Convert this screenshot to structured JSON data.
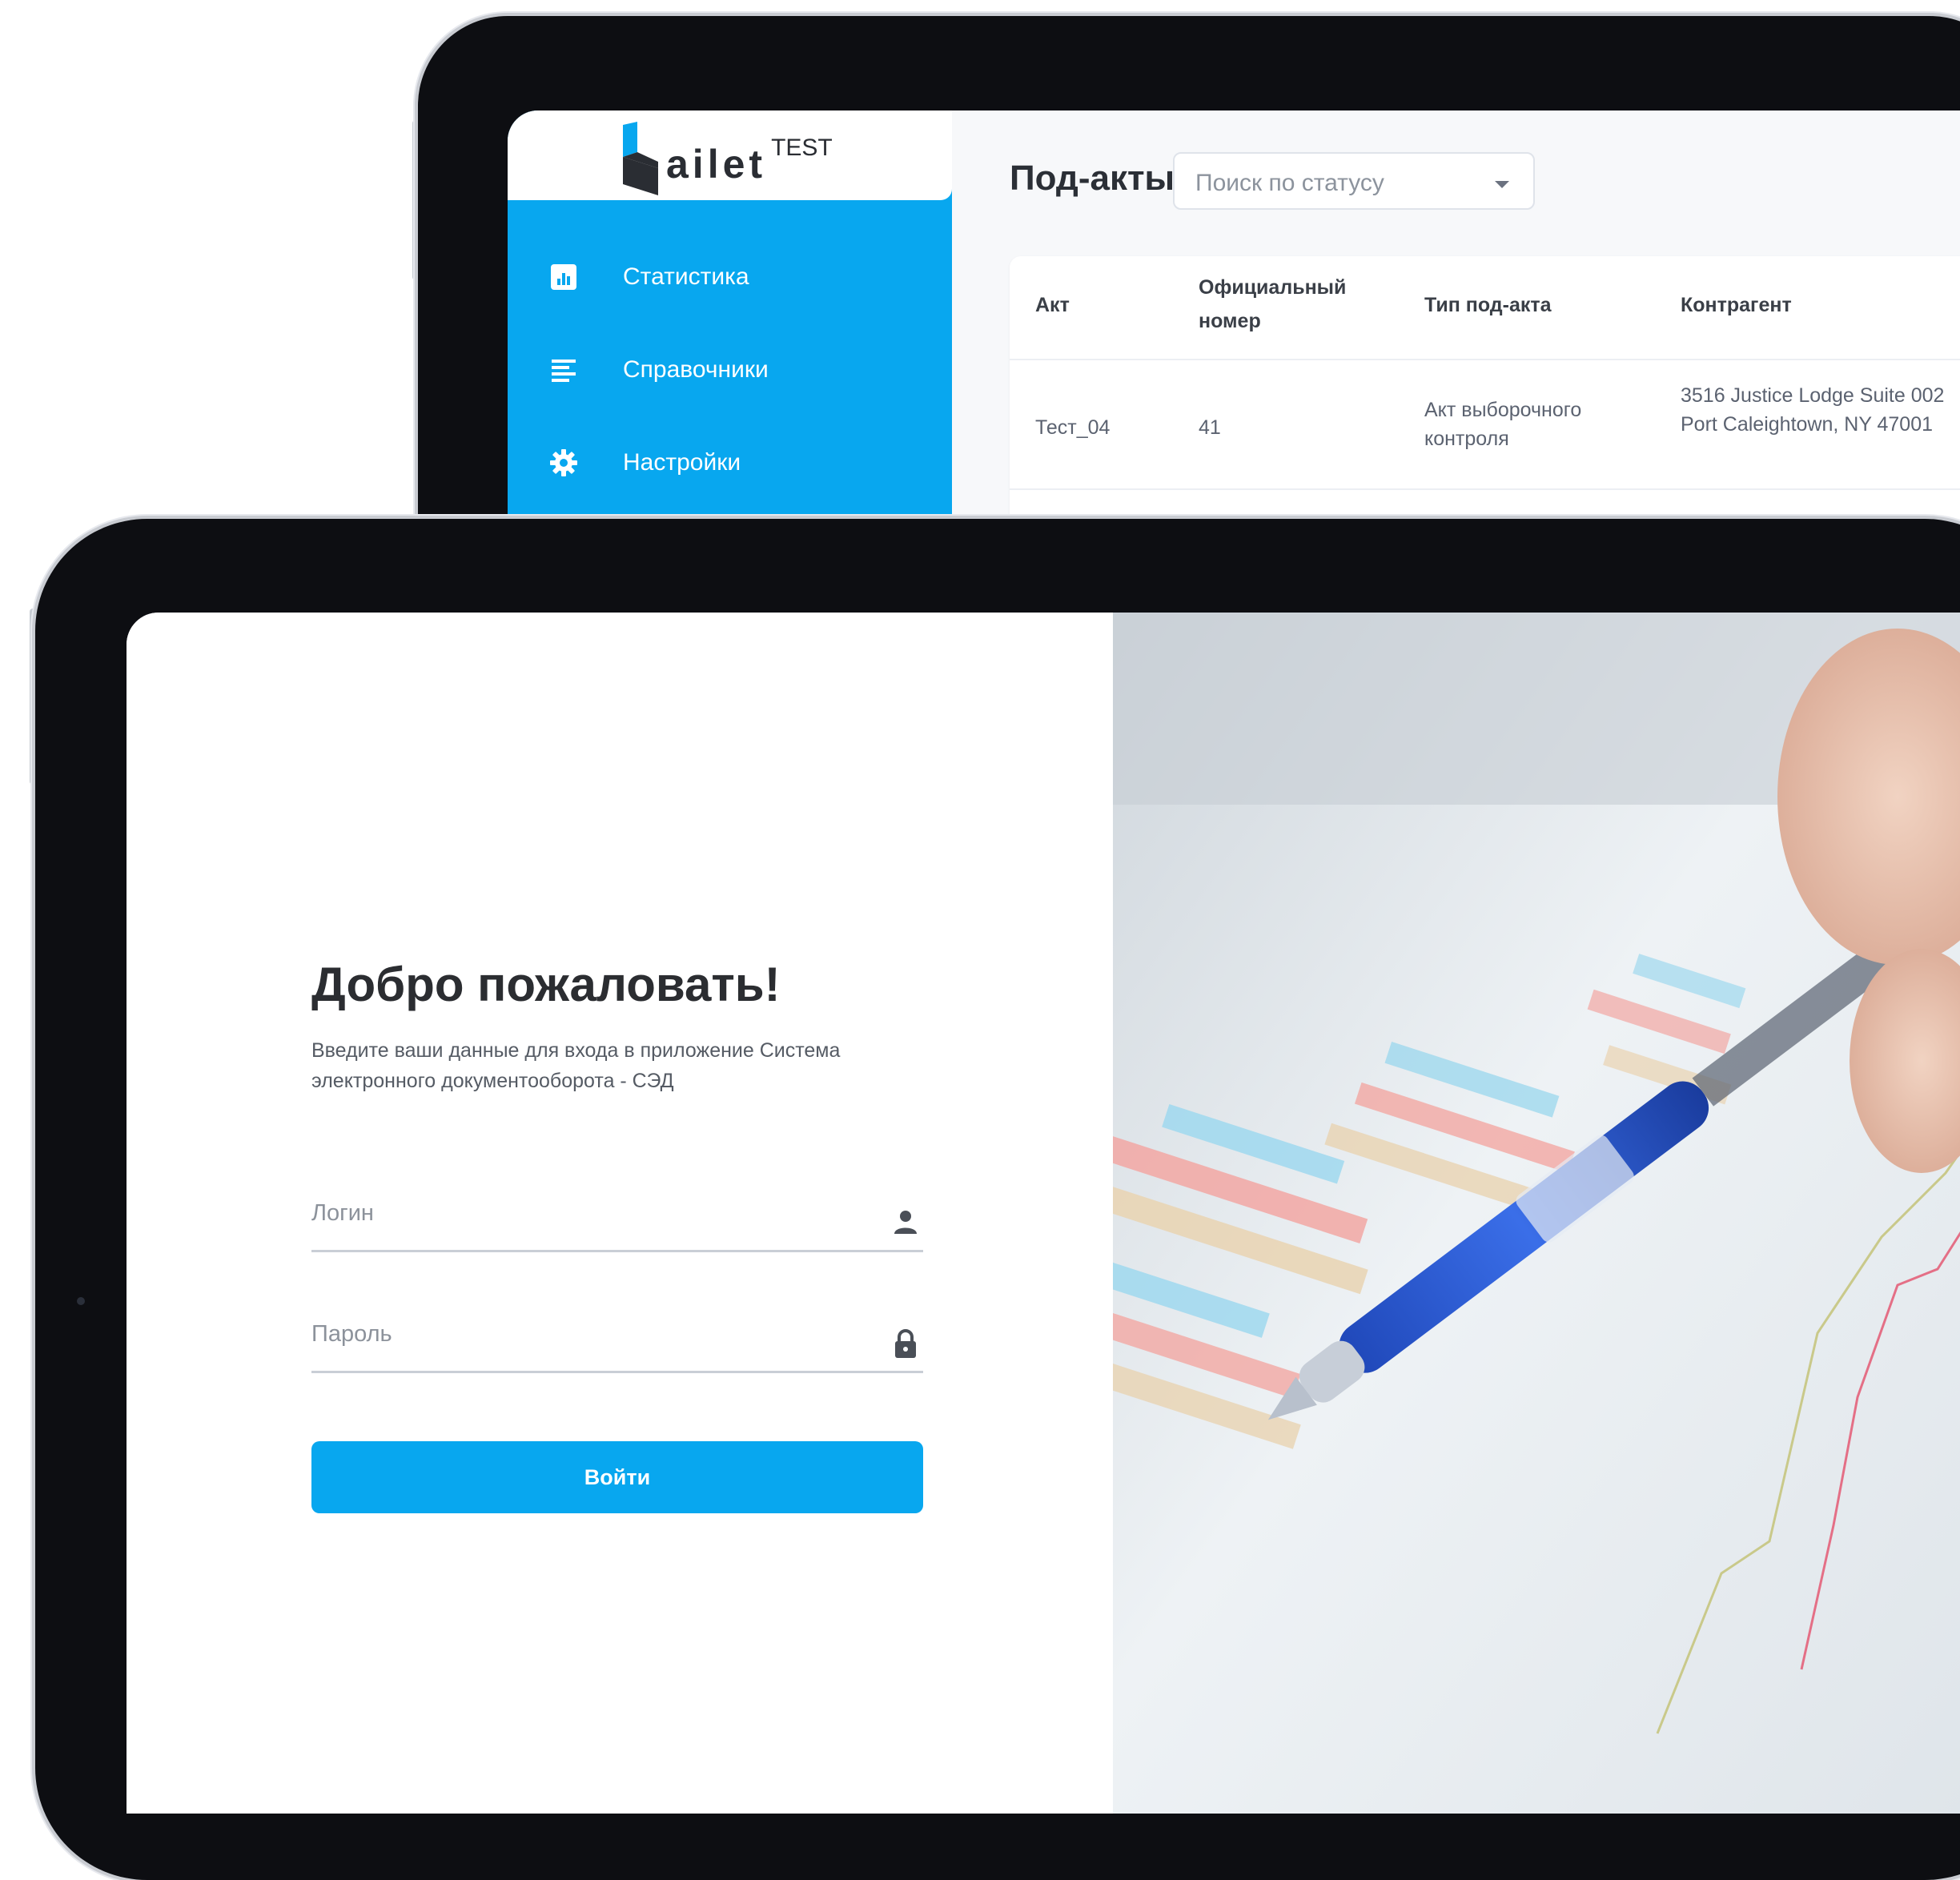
{
  "back_app": {
    "logo": {
      "word": "ailet",
      "suffix": "TEST"
    },
    "sidebar": {
      "items": [
        {
          "label": "Статистика",
          "icon": "chart-icon"
        },
        {
          "label": "Справочники",
          "icon": "list-icon"
        },
        {
          "label": "Настройки",
          "icon": "gear-icon"
        }
      ]
    },
    "header": {
      "title": "Под-акты",
      "status_search_placeholder": "Поиск по статусу"
    },
    "table": {
      "columns": [
        "Акт",
        "Официальный номер",
        "Тип под-акта",
        "Контрагент"
      ],
      "rows": [
        {
          "act": "Тест_04",
          "official_number": "41",
          "subact_type": "Акт выборочного контроля",
          "counterparty": "3516 Justice Lodge Suite 002 Port Caleightown, NY 47001"
        }
      ]
    }
  },
  "login": {
    "title": "Добро пожаловать!",
    "subtitle": "Введите ваши данные для входа в приложение Система электронного документооборота - СЭД",
    "login_placeholder": "Логин",
    "password_placeholder": "Пароль",
    "submit_label": "Войти"
  },
  "colors": {
    "accent": "#08a7ef",
    "bezel": "#0d0e12",
    "text_dark": "#2b2d31"
  }
}
